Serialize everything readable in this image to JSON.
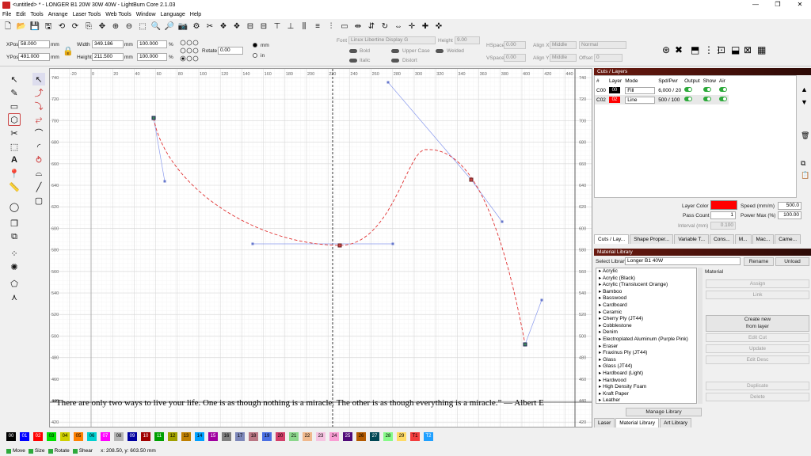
{
  "window": {
    "title": "<untitled> * - LONGER B1 20W 30W 40W - LightBurn Core 2.1.03",
    "min": "—",
    "max": "❐",
    "close": "✕"
  },
  "menu": [
    "File",
    "Edit",
    "Tools",
    "Arrange",
    "Laser Tools",
    "Web Tools",
    "Window",
    "Language",
    "Help"
  ],
  "toolbar_icons": [
    "new-file-icon",
    "open-folder-icon",
    "save-icon",
    "save-as-icon",
    "undo-icon",
    "redo-icon",
    "import-icon",
    "move-tool-icon",
    "zoom-in-icon",
    "zoom-out-icon",
    "zoom-frame-icon",
    "zoom-page-icon",
    "zoom-selection-icon",
    "camera-icon",
    "settings-icon",
    "tools-icon",
    "group-icon",
    "ungroup-icon",
    "align-left-icon",
    "align-right-icon",
    "align-top-icon",
    "align-bottom-icon",
    "align-hcenter-icon",
    "align-vcenter-icon",
    "distribute-icon",
    "dock-icon",
    "flip-h-icon",
    "flip-v-icon",
    "rotate-icon",
    "mirror-icon",
    "move-laser-icon",
    "frame-icon",
    "center-icon"
  ],
  "props": {
    "xpos_label": "XPos",
    "xpos": "58.000",
    "ypos_label": "YPos",
    "ypos": "491.000",
    "unit": "mm",
    "width_label": "Width",
    "width": "349.186",
    "height_label": "Height",
    "height": "211.500",
    "wpct": "100.000",
    "hpct": "100.000",
    "pct": "%",
    "rotate_label": "Rotate",
    "rotate": "0.00",
    "unit_mm": "mm",
    "unit_in": "in",
    "font_label": "Font",
    "font": "Linux Libertine Display G",
    "fheight_label": "Height",
    "fheight": "9.00",
    "hspace_label": "HSpace",
    "hspace": "0.00",
    "vspace_label": "VSpace",
    "vspace": "0.00",
    "alignx_label": "Align X",
    "alignx": "Middle",
    "aligny_label": "Align Y",
    "aligny": "Middle",
    "normal": "Normal",
    "offset_label": "Offset",
    "offset": "0",
    "bold": "Bold",
    "italic": "Italic",
    "uppercase": "Upper Case",
    "distort": "Distort",
    "welded": "Welded"
  },
  "ruler_x": [
    "-20",
    "0",
    "20",
    "40",
    "60",
    "80",
    "100",
    "120",
    "140",
    "160",
    "180",
    "200",
    "220",
    "240",
    "260",
    "280",
    "300",
    "320",
    "340",
    "360",
    "380",
    "400",
    "420",
    "440"
  ],
  "ruler_y": [
    "740",
    "720",
    "700",
    "680",
    "660",
    "640",
    "620",
    "600",
    "580",
    "560",
    "540",
    "520",
    "500",
    "480",
    "460",
    "440",
    "420"
  ],
  "canvas": {
    "quote": "“There are only two ways to live your life. One is as though nothing is a miracle. The other is as though everything is a miracle.” — Albert E"
  },
  "cuts": {
    "title": "Cuts / Layers",
    "headers": [
      "#",
      "Layer",
      "Mode",
      "Spd/Pwr",
      "Output",
      "Show",
      "Air"
    ],
    "rows": [
      {
        "num": "C00",
        "layer": "00",
        "color": "#000000",
        "mode": "Fill",
        "spdpwr": "6,000 / 20"
      },
      {
        "num": "C02",
        "layer": "02",
        "color": "#ff0000",
        "mode": "Line",
        "spdpwr": "500 / 100"
      }
    ],
    "layer_color_label": "Layer Color",
    "layer_color": "#ff0000",
    "speed_label": "Speed (mm/m)",
    "speed": "500.0",
    "pass_count_label": "Pass Count",
    "pass_count": "1",
    "power_max_label": "Power Max (%)",
    "power_max": "100.00",
    "interval_label": "Interval (mm)",
    "interval": "0.100",
    "tabs": [
      "Cuts / Lay...",
      "Shape Proper...",
      "Variable T...",
      "Cons...",
      "M...",
      "Mac...",
      "Came..."
    ]
  },
  "material": {
    "title": "Material Library",
    "select_label": "Select Library",
    "library": "Longer B1 40W",
    "rename": "Rename",
    "unload": "Unload",
    "material_label": "Material",
    "items": [
      "Acrylic",
      "Acrylic (Black)",
      "Acrylic (Translucent Orange)",
      "Bamboo",
      "Basswood",
      "Cardboard",
      "Ceramic",
      "Cherry Ply (JT44)",
      "Cobblestone",
      "Denim",
      "Electroplated Aluminum (Purple Pink)",
      "Eraser",
      "Fraxinus Ply (JT44)",
      "Glass",
      "Glass (JT44)",
      "Hardboard (Light)",
      "Hardwood",
      "High Density Foam",
      "Kraft Paper",
      "Leather"
    ],
    "assign": "Assign",
    "link": "Link",
    "create_new": "Create new",
    "from_layer": "from layer",
    "edit_cut": "Edit Cut",
    "update": "Update",
    "edit_desc": "Edit Desc",
    "duplicate": "Duplicate",
    "delete": "Delete",
    "manage": "Manage Library",
    "tabs": [
      "Laser",
      "Material Library",
      "Art Library"
    ]
  },
  "palette": [
    {
      "label": "00",
      "color": "#000000",
      "text": "#ffffff"
    },
    {
      "label": "01",
      "color": "#0000ff",
      "text": "#ffffff"
    },
    {
      "label": "02",
      "color": "#ff0000",
      "text": "#ffffff"
    },
    {
      "label": "03",
      "color": "#00e000",
      "text": "#000000"
    },
    {
      "label": "04",
      "color": "#d0d000",
      "text": "#000000"
    },
    {
      "label": "05",
      "color": "#ff8000",
      "text": "#000000"
    },
    {
      "label": "06",
      "color": "#00d0d0",
      "text": "#000000"
    },
    {
      "label": "07",
      "color": "#ff00ff",
      "text": "#ffffff"
    },
    {
      "label": "08",
      "color": "#b4b4b4",
      "text": "#000000"
    },
    {
      "label": "09",
      "color": "#0000a0",
      "text": "#ffffff"
    },
    {
      "label": "10",
      "color": "#a00000",
      "text": "#ffffff"
    },
    {
      "label": "11",
      "color": "#00a000",
      "text": "#ffffff"
    },
    {
      "label": "12",
      "color": "#a0a000",
      "text": "#000000"
    },
    {
      "label": "13",
      "color": "#c08000",
      "text": "#000000"
    },
    {
      "label": "14",
      "color": "#00a0ff",
      "text": "#000000"
    },
    {
      "label": "15",
      "color": "#a000a0",
      "text": "#ffffff"
    },
    {
      "label": "16",
      "color": "#808080",
      "text": "#000000"
    },
    {
      "label": "17",
      "color": "#7d87b9",
      "text": "#000000"
    },
    {
      "label": "18",
      "color": "#bb7784",
      "text": "#000000"
    },
    {
      "label": "19",
      "color": "#4a6fe3",
      "text": "#000000"
    },
    {
      "label": "20",
      "color": "#d33f6a",
      "text": "#000000"
    },
    {
      "label": "21",
      "color": "#8cd78c",
      "text": "#000000"
    },
    {
      "label": "22",
      "color": "#f0b98d",
      "text": "#000000"
    },
    {
      "label": "23",
      "color": "#f6c4e1",
      "text": "#000000"
    },
    {
      "label": "24",
      "color": "#fa9ed4",
      "text": "#000000"
    },
    {
      "label": "25",
      "color": "#500a78",
      "text": "#ffffff"
    },
    {
      "label": "26",
      "color": "#b45a00",
      "text": "#000000"
    },
    {
      "label": "27",
      "color": "#004754",
      "text": "#ffffff"
    },
    {
      "label": "28",
      "color": "#86fa88",
      "text": "#000000"
    },
    {
      "label": "29",
      "color": "#ffdb66",
      "text": "#000000"
    },
    {
      "label": "T1",
      "color": "#f33c3c",
      "text": "#000000"
    },
    {
      "label": "T2",
      "color": "#20a0ff",
      "text": "#ffffff"
    }
  ],
  "status": {
    "move": "Move",
    "size": "Size",
    "rotate": "Rotate",
    "shear": "Shear",
    "coords": "x: 208.50, y: 603.50 mm"
  }
}
